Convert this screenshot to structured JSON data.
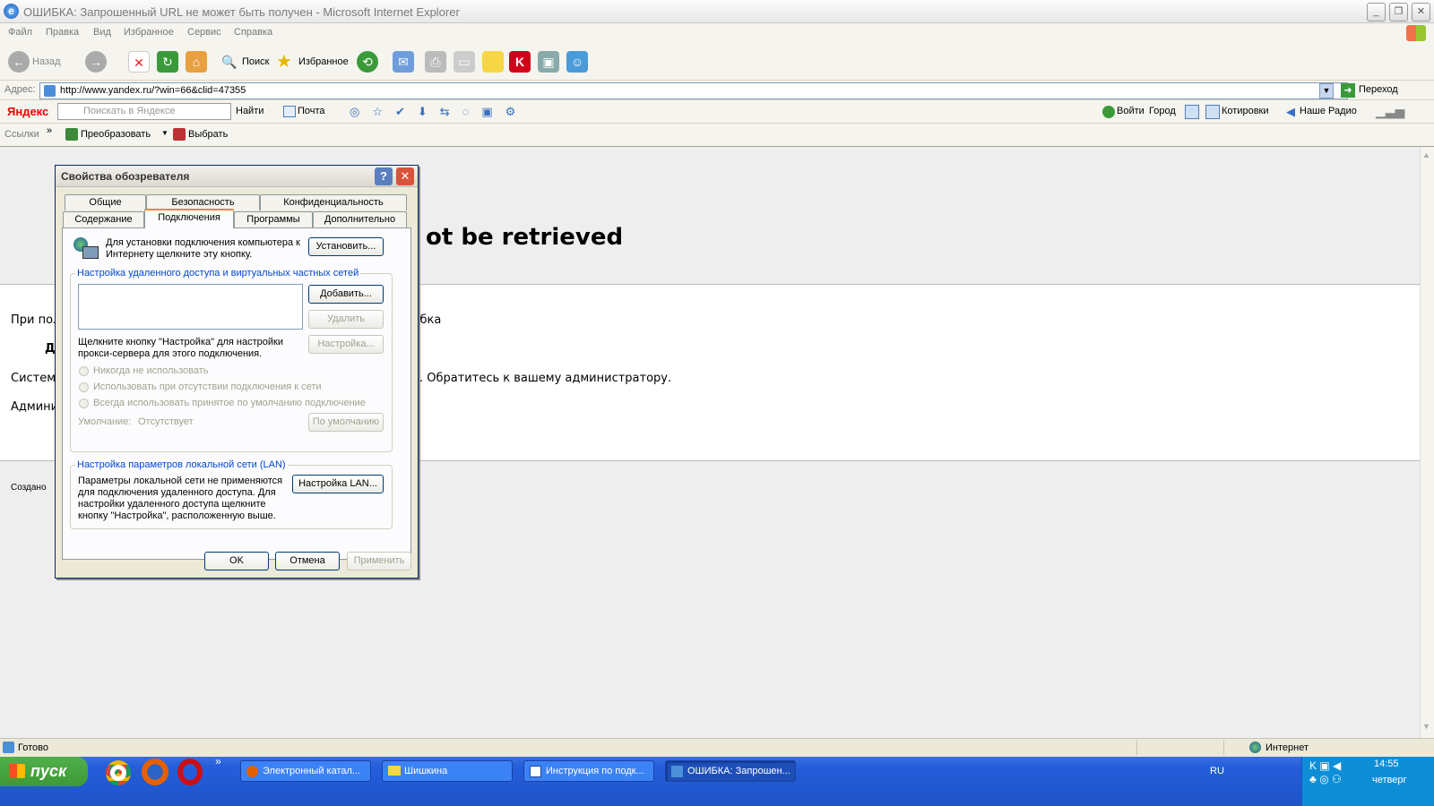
{
  "window": {
    "title": "ОШИБКА: Запрошенный URL не может быть получен - Microsoft Internet Explorer"
  },
  "menu": [
    "Файл",
    "Правка",
    "Вид",
    "Избранное",
    "Сервис",
    "Справка"
  ],
  "toolbar": {
    "back": "Назад",
    "search": "Поиск",
    "favorites": "Избранное"
  },
  "address": {
    "label": "Адрес:",
    "url": "http://www.yandex.ru/?win=66&clid=47355",
    "go": "Переход"
  },
  "yandex": {
    "logo": "Яндекс",
    "search_placeholder": "Поискать в Яндексе",
    "find": "Найти",
    "mail": "Почта",
    "login": "Войти",
    "city": "Город",
    "quotes": "Котировки",
    "radio": "Наше Радио"
  },
  "links": {
    "label": "Ссылки",
    "convert": "Преобразовать",
    "select": "Выбрать"
  },
  "page": {
    "title_fragment": "ot be retrieved",
    "line1_left": "При пол",
    "line1_right": "ибка",
    "line2_left": "Д",
    "line3_left": "Система",
    "line3_right": ". Обратитесь к вашему администратору.",
    "line4_left": "Админи",
    "footer_left": "Создано"
  },
  "dialog": {
    "title": "Свойства обозревателя",
    "tabs_row1": [
      "Общие",
      "Безопасность",
      "Конфиденциальность"
    ],
    "tabs_row2": [
      "Содержание",
      "Подключения",
      "Программы",
      "Дополнительно"
    ],
    "setup_text": "Для установки подключения компьютера к Интернету щелкните эту кнопку.",
    "setup_button": "Установить...",
    "dialup_group": "Настройка удаленного доступа и виртуальных частных сетей",
    "add_button": "Добавить...",
    "remove_button": "Удалить",
    "settings_button": "Настройка...",
    "proxy_hint": "Щелкните кнопку \"Настройка\" для настройки прокси-сервера для этого подключения.",
    "radio_never": "Никогда не использовать",
    "radio_absent": "Использовать при отсутствии подключения к сети",
    "radio_always": "Всегда использовать принятое по умолчанию подключение",
    "default_label": "Умолчание:",
    "default_value": "Отсутствует",
    "default_button": "По умолчанию",
    "lan_group": "Настройка параметров локальной сети (LAN)",
    "lan_text": "Параметры локальной сети не применяются для подключения удаленного доступа. Для настройки удаленного доступа щелкните кнопку \"Настройка\", расположенную выше.",
    "lan_button": "Настройка LAN...",
    "ok": "OK",
    "cancel": "Отмена",
    "apply": "Применить"
  },
  "status": {
    "left": "Готово",
    "zone": "Интернет"
  },
  "taskbar": {
    "start": "пуск",
    "tasks": [
      "Электронный катал...",
      "Шишкина",
      "Инструкция по подк...",
      "ОШИБКА: Запрошен..."
    ],
    "lang": "RU",
    "time": "14:55",
    "day": "четверг"
  }
}
